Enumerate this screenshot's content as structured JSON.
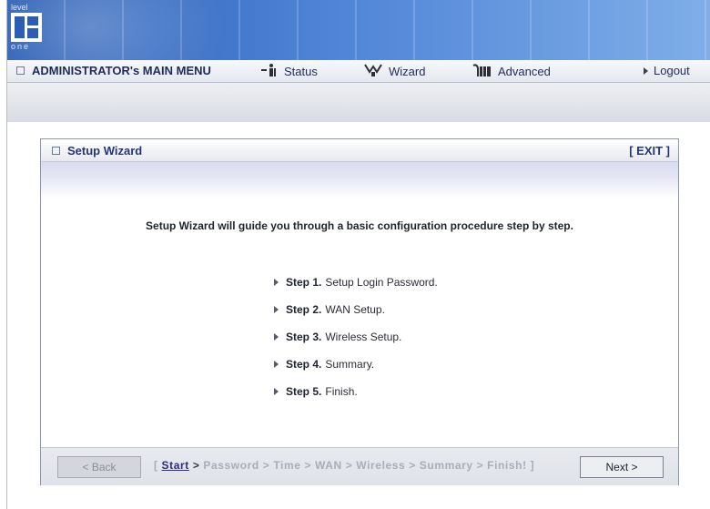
{
  "logo": {
    "top_text": "level",
    "bottom_text": "one"
  },
  "menu": {
    "main": "ADMINISTRATOR's MAIN MENU",
    "status": "Status",
    "wizard": "Wizard",
    "advanced": "Advanced",
    "logout": "Logout"
  },
  "panel": {
    "title": "Setup Wizard",
    "exit": "[ EXIT ]",
    "intro": "Setup Wizard will guide you through a basic configuration procedure step by step.",
    "steps": [
      {
        "num": "Step 1.",
        "text": "Setup Login Password."
      },
      {
        "num": "Step 2.",
        "text": "WAN Setup."
      },
      {
        "num": "Step 3.",
        "text": "Wireless Setup."
      },
      {
        "num": "Step 4.",
        "text": "Summary."
      },
      {
        "num": "Step 5.",
        "text": "Finish."
      }
    ]
  },
  "footer": {
    "back_label": "< Back",
    "next_label": "Next >",
    "crumb_open": "[",
    "crumb_current": "Start",
    "crumb_sep": ">",
    "crumb_rest": "Password > Time > WAN > Wireless > Summary > Finish!",
    "crumb_close": "]"
  },
  "colors": {
    "banner": "#2a5db3",
    "menu_text": "#26357a",
    "link_current": "#2a2a8c"
  }
}
